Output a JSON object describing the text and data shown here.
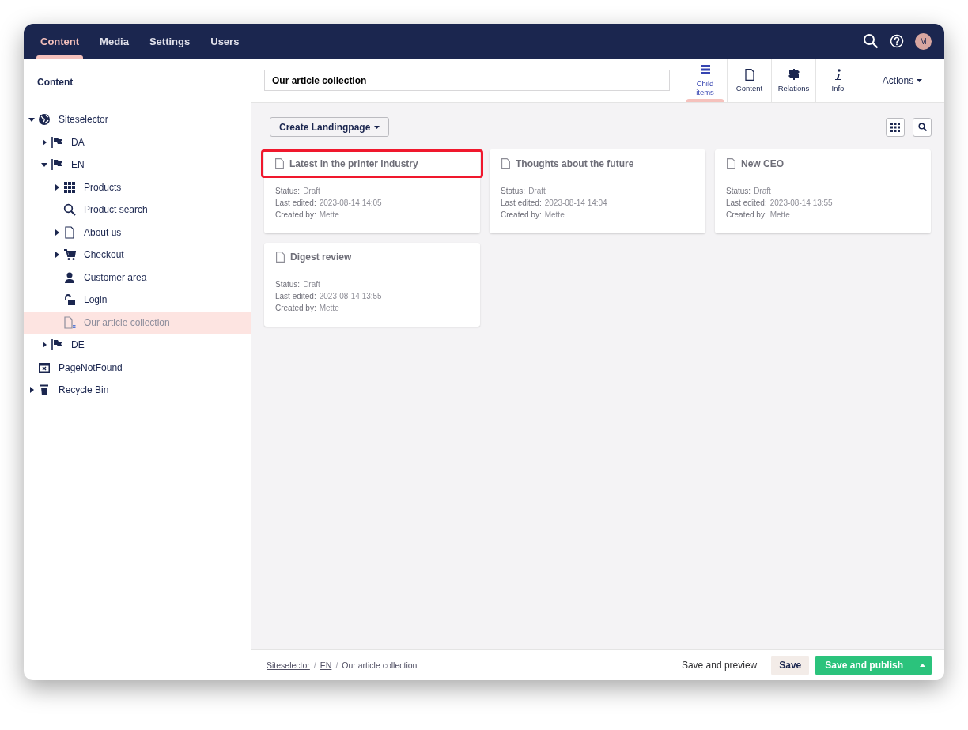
{
  "top_nav": {
    "sections": [
      {
        "label": "Content",
        "selected": true
      },
      {
        "label": "Media",
        "selected": false
      },
      {
        "label": "Settings",
        "selected": false
      },
      {
        "label": "Users",
        "selected": false
      }
    ],
    "avatar_initial": "M"
  },
  "sidebar": {
    "title": "Content",
    "tree": [
      {
        "label": "Siteselector",
        "kind": "site",
        "expandable": true,
        "expanded": true,
        "selected": false,
        "children": [
          {
            "label": "DA",
            "kind": "language",
            "expandable": true,
            "expanded": false,
            "selected": false
          },
          {
            "label": "EN",
            "kind": "language",
            "expandable": true,
            "expanded": true,
            "selected": false,
            "children": [
              {
                "label": "Products",
                "kind": "catalog",
                "expandable": true,
                "expanded": false,
                "selected": false
              },
              {
                "label": "Product search",
                "kind": "search-page",
                "expandable": false,
                "selected": false
              },
              {
                "label": "About us",
                "kind": "page",
                "expandable": true,
                "expanded": false,
                "selected": false
              },
              {
                "label": "Checkout",
                "kind": "checkout",
                "expandable": true,
                "expanded": false,
                "selected": false
              },
              {
                "label": "Customer area",
                "kind": "account",
                "expandable": false,
                "selected": false
              },
              {
                "label": "Login",
                "kind": "login",
                "expandable": false,
                "selected": false
              },
              {
                "label": "Our article collection",
                "kind": "collection",
                "expandable": false,
                "selected": true
              }
            ]
          },
          {
            "label": "DE",
            "kind": "language",
            "expandable": true,
            "expanded": false,
            "selected": false
          }
        ]
      },
      {
        "label": "PageNotFound",
        "kind": "error-page",
        "expandable": false,
        "selected": false
      },
      {
        "label": "Recycle Bin",
        "kind": "recycle-bin",
        "expandable": true,
        "expanded": false,
        "selected": false
      }
    ]
  },
  "editor": {
    "name_value": "Our article collection",
    "apps": [
      {
        "label": "Child items",
        "kind": "list",
        "selected": true
      },
      {
        "label": "Content",
        "kind": "document",
        "selected": false
      },
      {
        "label": "Relations",
        "kind": "signpost",
        "selected": false
      },
      {
        "label": "Info",
        "kind": "info",
        "selected": false
      }
    ],
    "actions_label": "Actions",
    "create_button": "Create Landingpage",
    "cards": [
      {
        "title": "Latest in the printer industry",
        "highlighted": true,
        "fields": [
          {
            "label": "Status:",
            "value": "Draft"
          },
          {
            "label": "Last edited:",
            "value": "2023-08-14 14:05"
          },
          {
            "label": "Created by:",
            "value": "Mette"
          }
        ]
      },
      {
        "title": "Thoughts about the future",
        "highlighted": false,
        "fields": [
          {
            "label": "Status:",
            "value": "Draft"
          },
          {
            "label": "Last edited:",
            "value": "2023-08-14 14:04"
          },
          {
            "label": "Created by:",
            "value": "Mette"
          }
        ]
      },
      {
        "title": "New CEO",
        "highlighted": false,
        "fields": [
          {
            "label": "Status:",
            "value": "Draft"
          },
          {
            "label": "Last edited:",
            "value": "2023-08-14 13:55"
          },
          {
            "label": "Created by:",
            "value": "Mette"
          }
        ]
      },
      {
        "title": "Digest review",
        "highlighted": false,
        "fields": [
          {
            "label": "Status:",
            "value": "Draft"
          },
          {
            "label": "Last edited:",
            "value": "2023-08-14 13:55"
          },
          {
            "label": "Created by:",
            "value": "Mette"
          }
        ]
      }
    ],
    "breadcrumb_separator": "/",
    "breadcrumb": [
      {
        "label": "Siteselector",
        "link": true
      },
      {
        "label": "EN",
        "link": true
      },
      {
        "label": "Our article collection",
        "link": false
      }
    ],
    "save_preview": "Save and preview",
    "save": "Save",
    "save_publish": "Save and publish"
  }
}
